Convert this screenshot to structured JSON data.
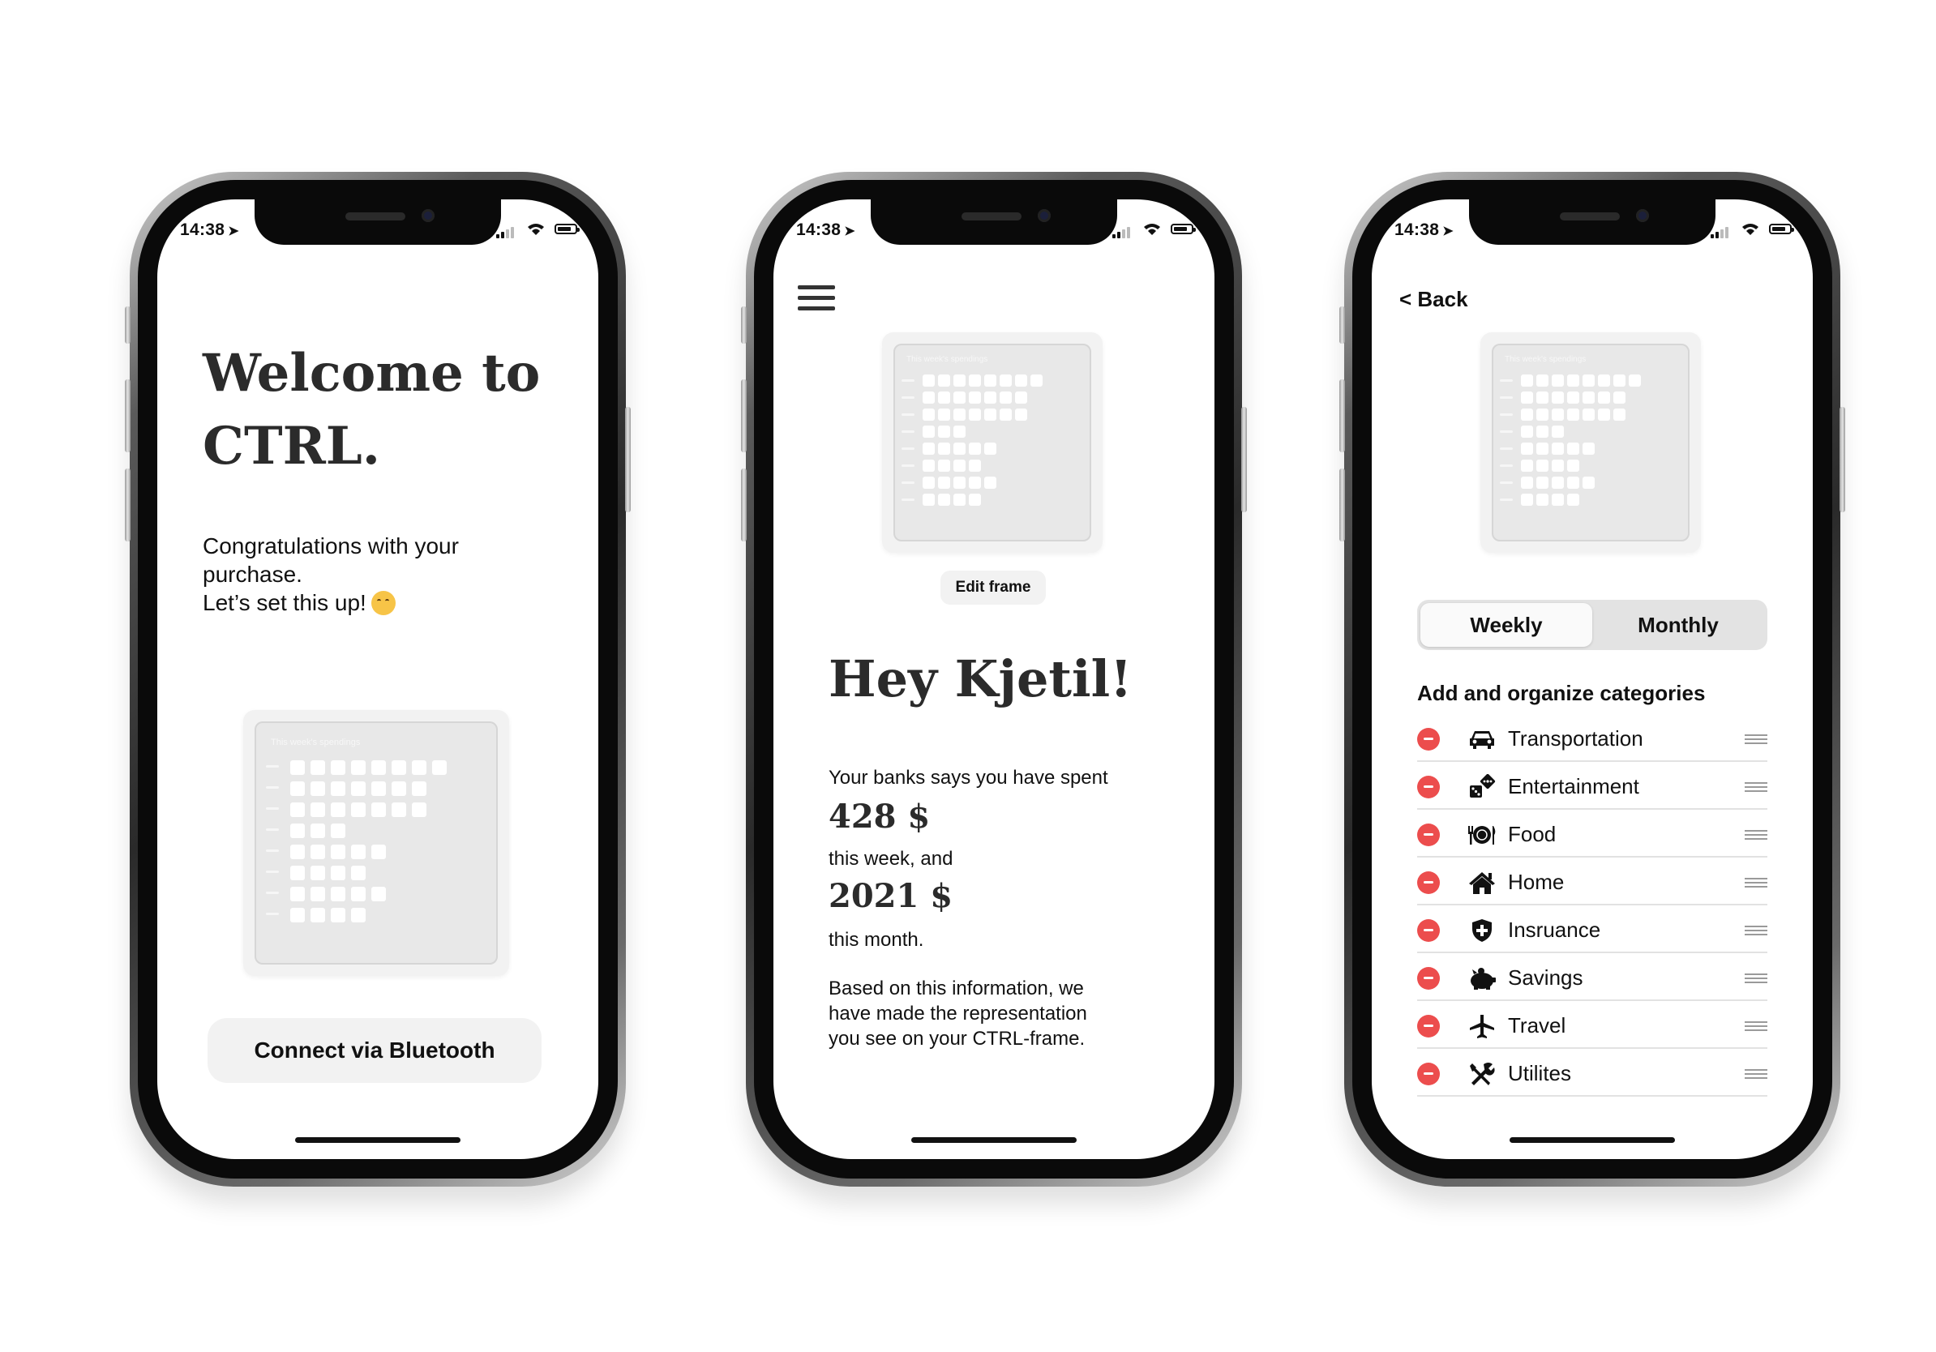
{
  "status": {
    "time": "14:38"
  },
  "screen1": {
    "title_line1": "Welcome to",
    "title_line2": "CTRL.",
    "body_line1": "Congratulations with your",
    "body_line2": "purchase.",
    "body_line3": "Let’s set this up!",
    "emoji_icon": "partying-face-icon",
    "connect_button": "Connect via Bluetooth"
  },
  "frame": {
    "title": "This week's spendings",
    "rows": [
      8,
      7,
      7,
      3,
      5,
      4,
      5,
      4
    ]
  },
  "screen2": {
    "menu_icon": "hamburger-menu-icon",
    "edit_button": "Edit frame",
    "greeting": "Hey Kjetil!",
    "line1": "Your banks says you have spent",
    "amount_week": "428 $",
    "line2": "this week, and",
    "amount_month": "2021 $",
    "line3": "this month.",
    "para_line1": "Based on this information, we",
    "para_line2": "have made the representation",
    "para_line3": "you see on your CTRL-frame."
  },
  "screen3": {
    "back": "< Back",
    "segment": {
      "weekly": "Weekly",
      "monthly": "Monthly",
      "selected": "Weekly"
    },
    "categories_title": "Add and organize categories",
    "categories": [
      {
        "label": "Transportation",
        "icon": "car-icon"
      },
      {
        "label": "Entertainment",
        "icon": "dice-icon"
      },
      {
        "label": "Food",
        "icon": "plate-cutlery-icon"
      },
      {
        "label": "Home",
        "icon": "house-icon"
      },
      {
        "label": "Insruance",
        "icon": "shield-icon"
      },
      {
        "label": "Savings",
        "icon": "piggy-bank-icon"
      },
      {
        "label": "Travel",
        "icon": "airplane-icon"
      },
      {
        "label": "Utilites",
        "icon": "tools-icon"
      }
    ]
  },
  "colors": {
    "accent_red": "#ec4d4d",
    "button_bg": "#f2f2f2",
    "segment_bg": "#e3e3e3",
    "heading": "#2b2b2b"
  }
}
